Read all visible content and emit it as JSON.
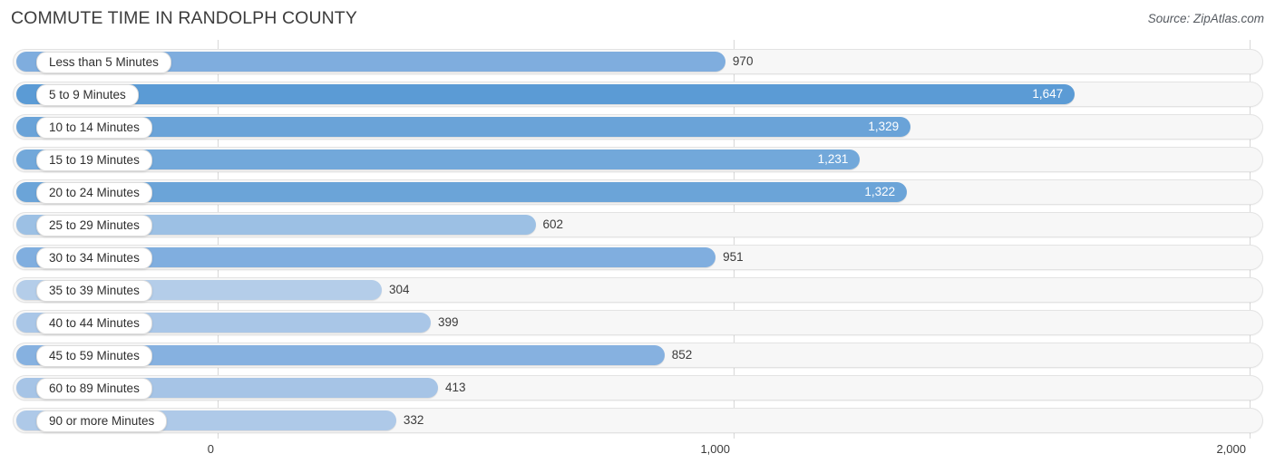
{
  "header": {
    "title": "COMMUTE TIME IN RANDOLPH COUNTY",
    "source": "Source: ZipAtlas.com"
  },
  "chart_data": {
    "type": "bar",
    "orientation": "horizontal",
    "title": "COMMUTE TIME IN RANDOLPH COUNTY",
    "xlabel": "",
    "ylabel": "",
    "xlim": [
      0,
      2000
    ],
    "grid": true,
    "legend": "none",
    "xticks": [
      "0",
      "1,000",
      "2,000"
    ],
    "xtick_values": [
      0,
      1000,
      2000
    ],
    "categories": [
      "Less than 5 Minutes",
      "5 to 9 Minutes",
      "10 to 14 Minutes",
      "15 to 19 Minutes",
      "20 to 24 Minutes",
      "25 to 29 Minutes",
      "30 to 34 Minutes",
      "35 to 39 Minutes",
      "40 to 44 Minutes",
      "45 to 59 Minutes",
      "60 to 89 Minutes",
      "90 or more Minutes"
    ],
    "values": [
      970,
      1647,
      1329,
      1231,
      1322,
      602,
      951,
      304,
      399,
      852,
      413,
      332
    ],
    "value_labels": [
      "970",
      "1,647",
      "1,329",
      "1,231",
      "1,322",
      "602",
      "951",
      "304",
      "399",
      "852",
      "413",
      "332"
    ],
    "bar_colors": [
      "#7fadde",
      "#5b9bd5",
      "#6aa3d8",
      "#72a8da",
      "#6ba4d8",
      "#9cc0e4",
      "#80aedf",
      "#b4cde9",
      "#a9c6e7",
      "#86b1e0",
      "#a6c4e6",
      "#aec9e8"
    ]
  },
  "axis": {
    "ticks": [
      {
        "label": "0",
        "value": 0
      },
      {
        "label": "1,000",
        "value": 1000
      },
      {
        "label": "2,000",
        "value": 2000
      }
    ]
  }
}
